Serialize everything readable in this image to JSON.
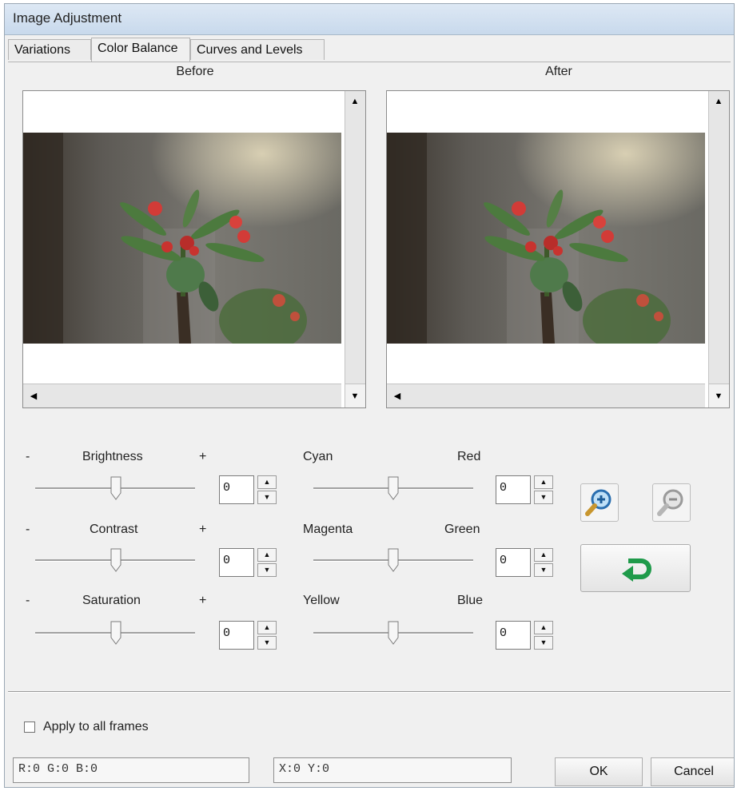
{
  "window": {
    "title": "Image Adjustment"
  },
  "tabs": [
    {
      "label": "Variations",
      "active": false
    },
    {
      "label": "Color Balance",
      "active": true
    },
    {
      "label": "Curves and Levels",
      "active": false
    }
  ],
  "panels": {
    "before_label": "Before",
    "after_label": "After"
  },
  "left_sliders": [
    {
      "minus": "-",
      "label": "Brightness",
      "plus": "+",
      "value": "0"
    },
    {
      "minus": "-",
      "label": "Contrast",
      "plus": "+",
      "value": "0"
    },
    {
      "minus": "-",
      "label": "Saturation",
      "plus": "+",
      "value": "0"
    }
  ],
  "color_sliders": [
    {
      "left_label": "Cyan",
      "right_label": "Red",
      "value": "0"
    },
    {
      "left_label": "Magenta",
      "right_label": "Green",
      "value": "0"
    },
    {
      "left_label": "Yellow",
      "right_label": "Blue",
      "value": "0"
    }
  ],
  "icons": {
    "zoom_in": "zoom-in-icon",
    "zoom_out": "zoom-out-icon",
    "reset": "reset-arrow-icon"
  },
  "apply_all": {
    "label": "Apply to all frames",
    "checked": false
  },
  "status": {
    "rgb": "R:0 G:0 B:0",
    "xy": "X:0 Y:0"
  },
  "buttons": {
    "ok": "OK",
    "cancel": "Cancel"
  },
  "colors": {
    "accent_green": "#1f9a4a",
    "title_bar": "#cfe0f1"
  }
}
